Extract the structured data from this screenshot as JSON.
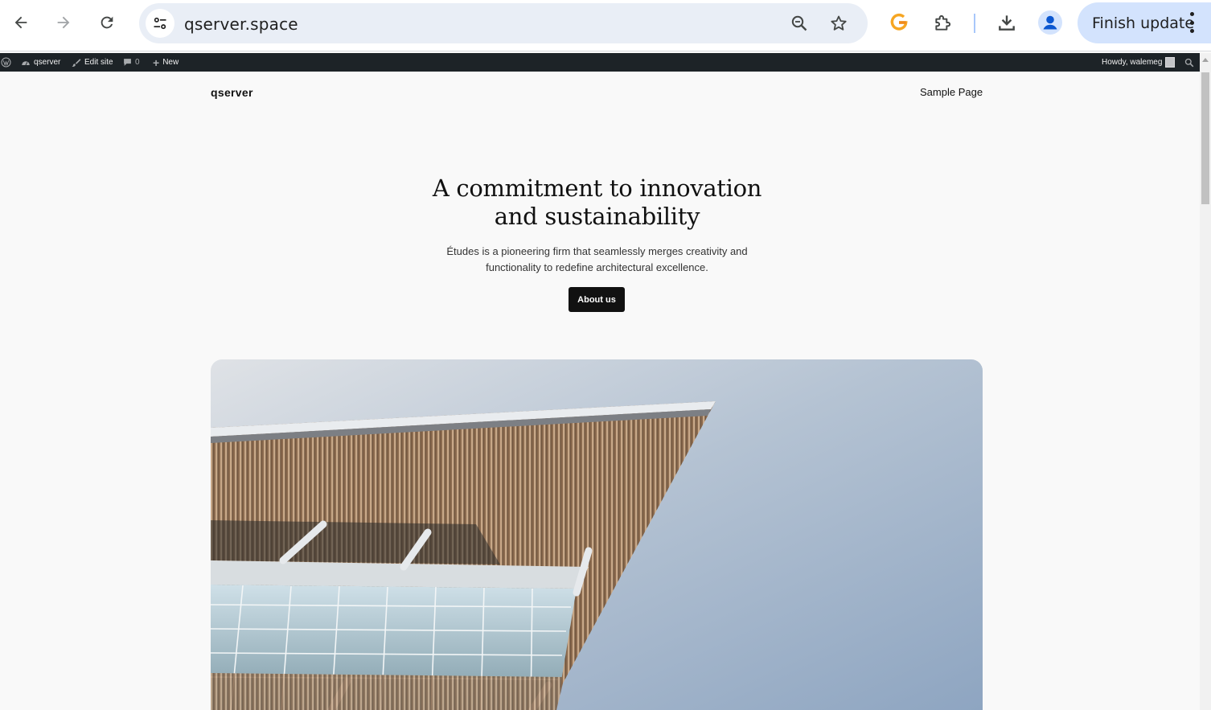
{
  "browser": {
    "url": "qserver.space",
    "finish_update_label": "Finish update"
  },
  "admin_bar": {
    "site_name": "qserver",
    "edit_site": "Edit site",
    "comments_count": "0",
    "new_label": "New",
    "howdy": "Howdy, walemeg"
  },
  "site": {
    "title": "qserver",
    "nav_link": "Sample Page"
  },
  "hero": {
    "heading_line1": "A commitment to innovation",
    "heading_line2": "and sustainability",
    "subtitle_line1": "Études is a pioneering firm that seamlessly merges creativity and",
    "subtitle_line2": "functionality to redefine architectural excellence.",
    "button_label": "About us"
  },
  "colors": {
    "page_bg": "#f9f9f9",
    "admin_bar_bg": "#1d2327",
    "button_bg": "#111111",
    "finish_update_bg": "#d3e3fd",
    "omnibox_bg": "#e9eef6"
  }
}
